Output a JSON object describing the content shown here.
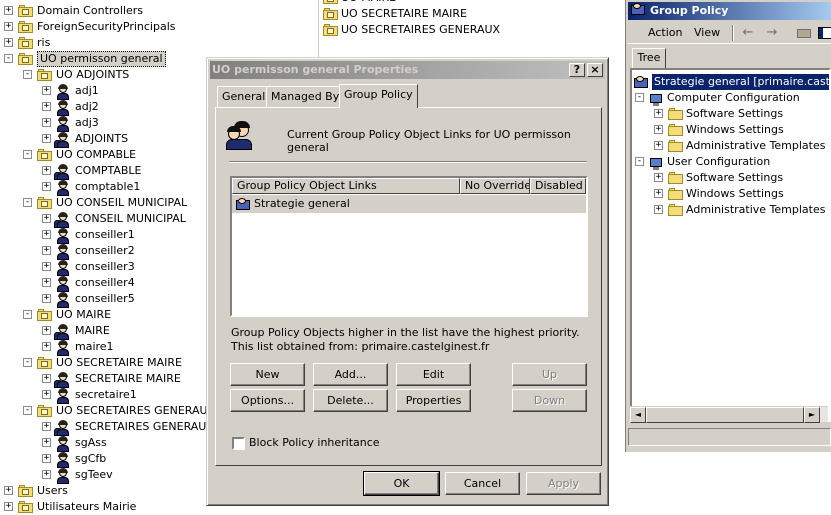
{
  "ad_tree": {
    "items": [
      {
        "label": "Domain Controllers",
        "kind": "ou",
        "level": 0,
        "expander": "+"
      },
      {
        "label": "ForeignSecurityPrincipals",
        "kind": "ou",
        "level": 0,
        "expander": "+"
      },
      {
        "label": "ris",
        "kind": "ou",
        "level": 0,
        "expander": "+"
      },
      {
        "label": "UO permisson general",
        "kind": "ou",
        "level": 0,
        "expander": "-",
        "selected": true
      },
      {
        "label": "UO ADJOINTS",
        "kind": "ou",
        "level": 1,
        "expander": "-"
      },
      {
        "label": "adj1",
        "kind": "user",
        "level": 2,
        "expander": "+"
      },
      {
        "label": "adj2",
        "kind": "user",
        "level": 2,
        "expander": "+"
      },
      {
        "label": "adj3",
        "kind": "user",
        "level": 2,
        "expander": "+"
      },
      {
        "label": "ADJOINTS",
        "kind": "group",
        "level": 2,
        "expander": "+"
      },
      {
        "label": "UO COMPABLE",
        "kind": "ou",
        "level": 1,
        "expander": "-"
      },
      {
        "label": "COMPTABLE",
        "kind": "group",
        "level": 2,
        "expander": "+"
      },
      {
        "label": "comptable1",
        "kind": "user",
        "level": 2,
        "expander": "+"
      },
      {
        "label": "UO CONSEIL MUNICIPAL",
        "kind": "ou",
        "level": 1,
        "expander": "-"
      },
      {
        "label": "CONSEIL MUNICIPAL",
        "kind": "group",
        "level": 2,
        "expander": "+"
      },
      {
        "label": "conseiller1",
        "kind": "user",
        "level": 2,
        "expander": "+"
      },
      {
        "label": "conseiller2",
        "kind": "user",
        "level": 2,
        "expander": "+"
      },
      {
        "label": "conseiller3",
        "kind": "user",
        "level": 2,
        "expander": "+"
      },
      {
        "label": "conseiller4",
        "kind": "user",
        "level": 2,
        "expander": "+"
      },
      {
        "label": "conseiller5",
        "kind": "user",
        "level": 2,
        "expander": "+"
      },
      {
        "label": "UO MAIRE",
        "kind": "ou",
        "level": 1,
        "expander": "-"
      },
      {
        "label": "MAIRE",
        "kind": "group",
        "level": 2,
        "expander": "+"
      },
      {
        "label": "maire1",
        "kind": "user",
        "level": 2,
        "expander": "+"
      },
      {
        "label": "UO SECRETAIRE MAIRE",
        "kind": "ou",
        "level": 1,
        "expander": "-"
      },
      {
        "label": "SECRETAIRE MAIRE",
        "kind": "group",
        "level": 2,
        "expander": "+"
      },
      {
        "label": "secretaire1",
        "kind": "user",
        "level": 2,
        "expander": "+"
      },
      {
        "label": "UO SECRETAIRES GENERAUX",
        "kind": "ou",
        "level": 1,
        "expander": "-"
      },
      {
        "label": "SECRETAIRES GENERAUX",
        "kind": "group",
        "level": 2,
        "expander": "+"
      },
      {
        "label": "sgAss",
        "kind": "user",
        "level": 2,
        "expander": "+"
      },
      {
        "label": "sgCfb",
        "kind": "user",
        "level": 2,
        "expander": "+"
      },
      {
        "label": "sgTeev",
        "kind": "user",
        "level": 2,
        "expander": "+"
      },
      {
        "label": "Users",
        "kind": "ou",
        "level": 0,
        "expander": "+"
      },
      {
        "label": "Utilisateurs Mairie",
        "kind": "ou",
        "level": 0,
        "expander": "+"
      }
    ]
  },
  "mid_panel": {
    "items": [
      {
        "label": "UO MAIRE",
        "kind": "ou"
      },
      {
        "label": "UO SECRETAIRE MAIRE",
        "kind": "ou"
      },
      {
        "label": "UO SECRETAIRES GENERAUX",
        "kind": "ou"
      }
    ]
  },
  "gp_window": {
    "title": "Group Policy",
    "menu": {
      "action": "Action",
      "view": "View"
    },
    "toolbar": {
      "back": "←",
      "forward": "→"
    },
    "tab": "Tree",
    "tree": [
      {
        "label": "Strategie general [primaire.castelginest.fr]",
        "kind": "gpo",
        "level": 0,
        "expander": "",
        "selected": true
      },
      {
        "label": "Computer Configuration",
        "kind": "config",
        "level": 1,
        "expander": "-"
      },
      {
        "label": "Software Settings",
        "kind": "folder",
        "level": 2,
        "expander": "+"
      },
      {
        "label": "Windows Settings",
        "kind": "folder",
        "level": 2,
        "expander": "+"
      },
      {
        "label": "Administrative Templates",
        "kind": "folder",
        "level": 2,
        "expander": "+"
      },
      {
        "label": "User Configuration",
        "kind": "config",
        "level": 1,
        "expander": "-"
      },
      {
        "label": "Software Settings",
        "kind": "folder",
        "level": 2,
        "expander": "+"
      },
      {
        "label": "Windows Settings",
        "kind": "folder",
        "level": 2,
        "expander": "+"
      },
      {
        "label": "Administrative Templates",
        "kind": "folder",
        "level": 2,
        "expander": "+"
      }
    ],
    "scroll_left": "◄",
    "scroll_right": "►"
  },
  "dialog": {
    "title": "UO permisson general Properties",
    "help_btn": "?",
    "close_btn": "×",
    "tabs": [
      "General",
      "Managed By",
      "Group Policy"
    ],
    "active_tab": "Group Policy",
    "header_text": "Current Group Policy Object Links for UO permisson general",
    "list": {
      "columns": [
        "Group Policy Object Links",
        "No Override",
        "Disabled"
      ],
      "rows": [
        {
          "name": "Strategie general",
          "no_override": "",
          "disabled": ""
        }
      ]
    },
    "info_line1": "Group Policy Objects higher in the list have the highest priority.",
    "info_line2": "This list obtained from: primaire.castelginest.fr",
    "buttons": {
      "new": "New",
      "add": "Add...",
      "edit": "Edit",
      "up": "Up",
      "options": "Options...",
      "delete": "Delete...",
      "properties": "Properties",
      "down": "Down"
    },
    "block_inheritance": {
      "label": "Block Policy inheritance",
      "checked": false
    },
    "footer": {
      "ok": "OK",
      "cancel": "Cancel",
      "apply": "Apply"
    }
  },
  "colors": {
    "active_title": "#0a246a",
    "inactive_title": "#808080",
    "window_face": "#d4d0c8"
  }
}
